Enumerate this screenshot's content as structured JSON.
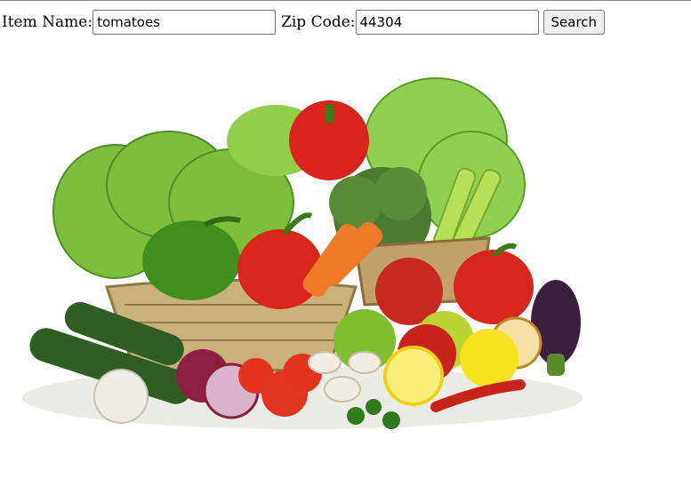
{
  "form": {
    "item_label": "Item Name:",
    "item_value": "tomatoes",
    "zip_label": "Zip Code:",
    "zip_value": "44304",
    "search_label": "Search"
  }
}
